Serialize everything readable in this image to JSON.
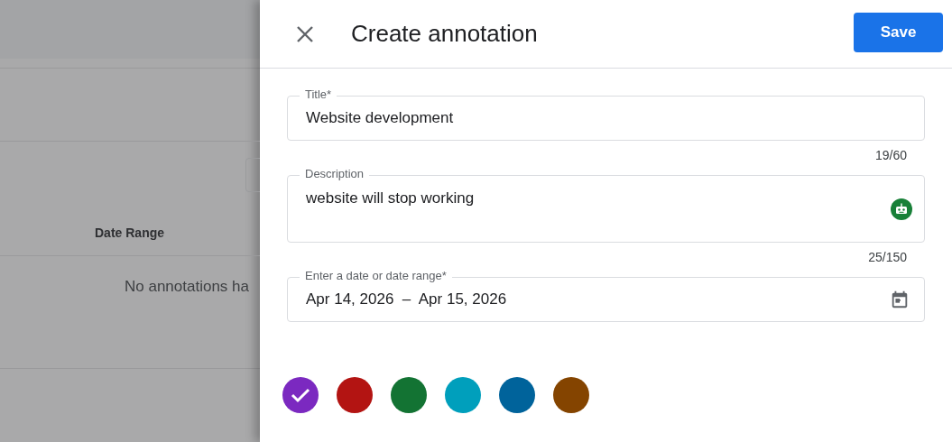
{
  "background": {
    "column_header": "Date Range",
    "empty_message": "No annotations ha"
  },
  "panel": {
    "title": "Create annotation",
    "save_button": "Save",
    "fields": [
      {
        "kind": "text",
        "label": "Title*",
        "value": "Website development",
        "counter": "19/60"
      },
      {
        "kind": "textarea",
        "label": "Description",
        "value": "website will stop working",
        "counter": "25/150"
      },
      {
        "kind": "date",
        "label": "Enter a date or date range*",
        "value": "Apr 14, 2026  –  Apr 15, 2026"
      }
    ],
    "colors": [
      {
        "color": "#7b29c0",
        "selected": true
      },
      {
        "color": "#b31412",
        "selected": false
      },
      {
        "color": "#137333",
        "selected": false
      },
      {
        "color": "#009fbc",
        "selected": false
      },
      {
        "color": "#00639b",
        "selected": false
      },
      {
        "color": "#844400",
        "selected": false
      }
    ]
  }
}
